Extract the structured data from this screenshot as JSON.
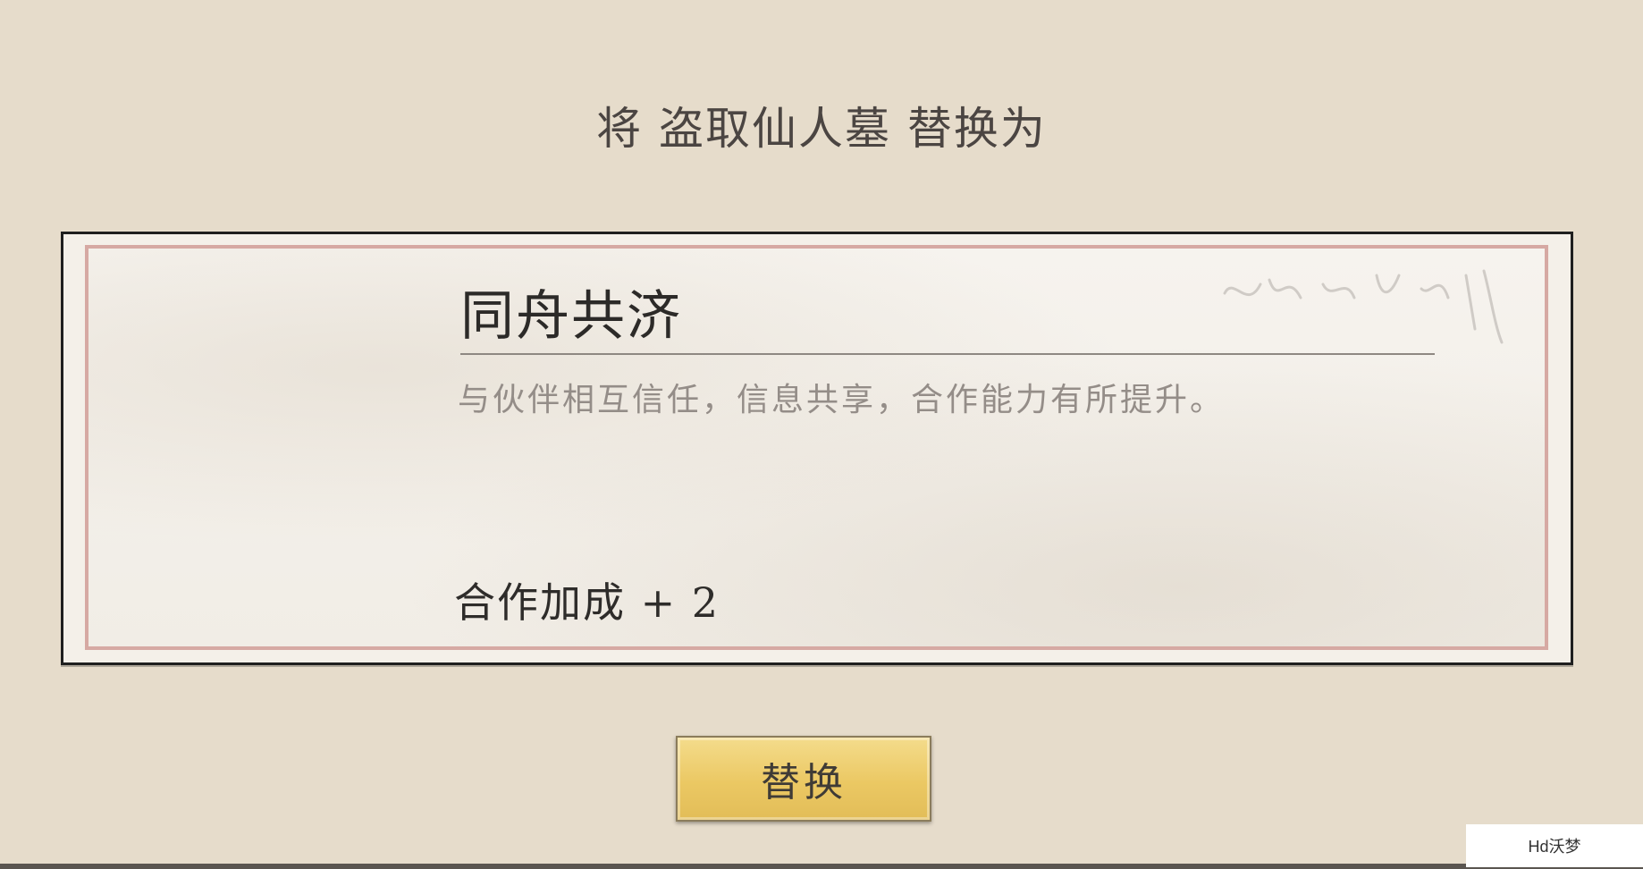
{
  "dialog": {
    "title": "将 盗取仙人墓 替换为"
  },
  "card": {
    "title": "同舟共济",
    "description": "与伙伴相互信任，信息共享，合作能力有所提升。",
    "bonus": "合作加成 + 2"
  },
  "actions": {
    "replace_label": "替换"
  },
  "watermark": {
    "text": "Hd沃梦"
  },
  "colors": {
    "background": "#e6dccb",
    "button_gold": "#ebc863",
    "card_border": "#d6a9a3"
  }
}
